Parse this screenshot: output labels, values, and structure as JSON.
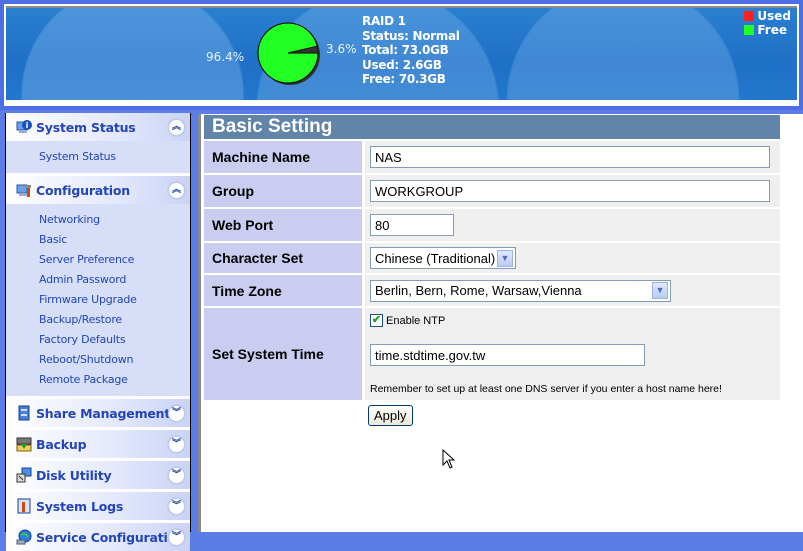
{
  "header": {
    "free_pct_label": "96.4%",
    "used_pct_label": "3.6%",
    "raid": {
      "name": "RAID 1",
      "status": "Status: Normal",
      "total": "Total: 73.0GB",
      "used": "Used: 2.6GB",
      "free": "Free: 70.3GB"
    },
    "legend": [
      {
        "label": "Used",
        "color": "#ff2020"
      },
      {
        "label": "Free",
        "color": "#22ff22"
      }
    ],
    "usage": {
      "used_fraction": 0.036,
      "free_fraction": 0.964,
      "free_color": "#22ff22",
      "used_color": "#333333"
    }
  },
  "sidebar": {
    "sections": [
      {
        "label": "System Status",
        "icon": "info-monitor-icon",
        "expanded": true,
        "items": [
          "System Status"
        ]
      },
      {
        "label": "Configuration",
        "icon": "config-tools-icon",
        "expanded": true,
        "items": [
          "Networking",
          "Basic",
          "Server Preference",
          "Admin Password",
          "Firmware Upgrade",
          "Backup/Restore",
          "Factory Defaults",
          "Reboot/Shutdown",
          "Remote Package"
        ]
      },
      {
        "label": "Share Management",
        "icon": "share-icon",
        "expanded": false,
        "items": []
      },
      {
        "label": "Backup",
        "icon": "backup-icon",
        "expanded": false,
        "items": []
      },
      {
        "label": "Disk Utility",
        "icon": "disk-utility-icon",
        "expanded": false,
        "items": []
      },
      {
        "label": "System Logs",
        "icon": "system-logs-icon",
        "expanded": false,
        "items": []
      },
      {
        "label": "Service Configuration",
        "icon": "service-globe-icon",
        "expanded": false,
        "items": []
      }
    ],
    "collapse_glyph": "︽",
    "expand_glyph": "︾"
  },
  "main": {
    "title": "Basic Setting",
    "fields": {
      "machine_name": {
        "label": "Machine Name",
        "value": "NAS"
      },
      "group": {
        "label": "Group",
        "value": "WORKGROUP"
      },
      "web_port": {
        "label": "Web Port",
        "value": "80"
      },
      "charset": {
        "label": "Character Set",
        "value": "Chinese (Traditional)"
      },
      "timezone": {
        "label": "Time Zone",
        "value": "Berlin, Bern, Rome, Warsaw,Vienna"
      },
      "system_time": {
        "label": "Set System Time",
        "ntp_label": "Enable NTP",
        "ntp_checked": true,
        "ntp_server": "time.stdtime.gov.tw",
        "note": "Remember to set up at least one DNS server if you enter a host name here!"
      }
    },
    "apply_label": "Apply"
  }
}
